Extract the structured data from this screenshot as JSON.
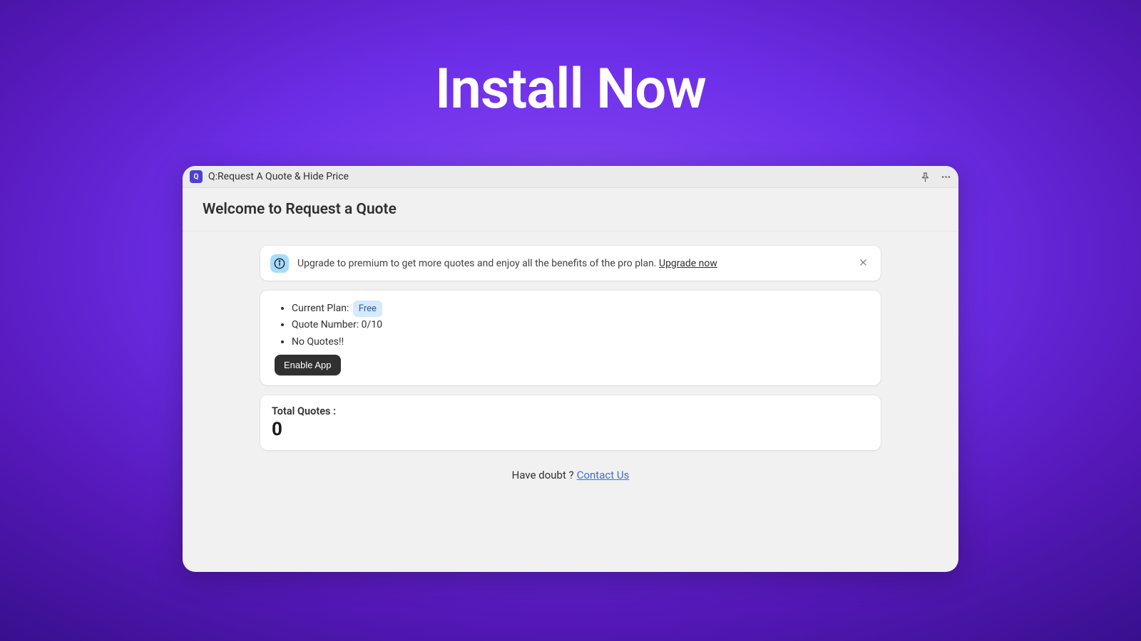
{
  "headline": "Install Now",
  "titlebar": {
    "app_icon_letter": "Q",
    "title": "Q:Request A Quote & Hide Price"
  },
  "page": {
    "title": "Welcome to Request a Quote"
  },
  "banner": {
    "text": "Upgrade to premium to get more quotes and enjoy all the benefits of the pro plan. ",
    "link_label": "Upgrade now"
  },
  "plan": {
    "current_label": "Current Plan:",
    "current_value": "Free",
    "quote_number_label": "Quote Number: 0/10",
    "no_quotes_label": "No Quotes!!",
    "enable_button": "Enable App"
  },
  "totals": {
    "label": "Total Quotes :",
    "value": "0"
  },
  "contact": {
    "text": "Have doubt ? ",
    "link_label": "Contact Us"
  }
}
